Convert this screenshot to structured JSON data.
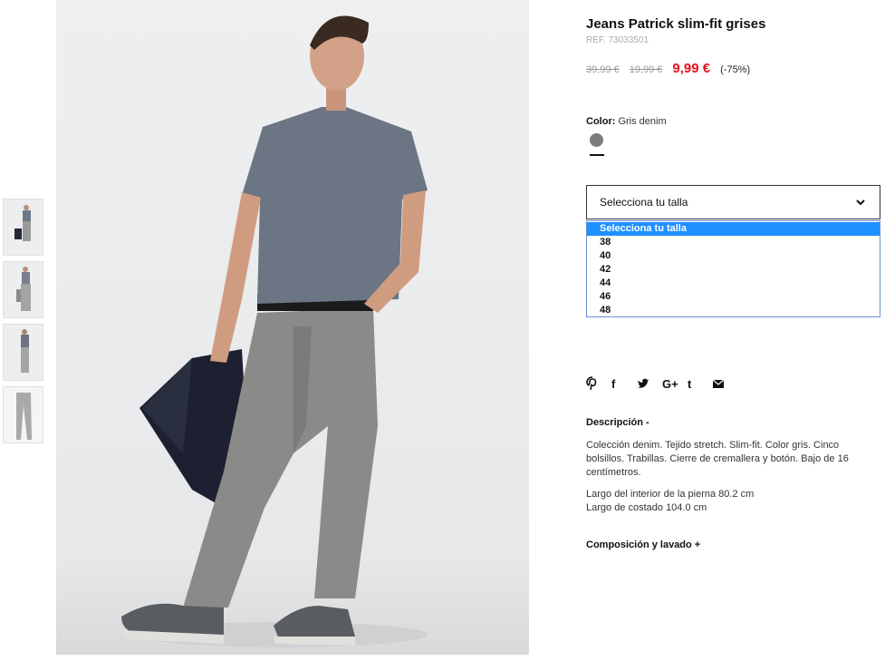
{
  "product": {
    "title": "Jeans Patrick slim-fit grises",
    "ref": "REF. 73033501",
    "price_original": "39,99 €",
    "price_previous": "19,99 €",
    "price_current": "9,99 €",
    "discount": "(-75%)"
  },
  "color": {
    "label": "Color:",
    "value": "Gris denim",
    "swatch_hex": "#7b7b7d"
  },
  "size": {
    "select_label": "Selecciona tu talla",
    "options": [
      "Selecciona tu talla",
      "38",
      "40",
      "42",
      "44",
      "46",
      "48"
    ],
    "selected_index": 0,
    "highlight_color": "#1e90ff"
  },
  "social": {
    "icons": [
      "pinterest-icon",
      "facebook-icon",
      "twitter-icon",
      "google-plus-icon",
      "tumblr-icon",
      "email-icon"
    ],
    "facebook_glyph": "f",
    "google_glyph": "G+",
    "tumblr_glyph": "t"
  },
  "description": {
    "heading": "Descripción -",
    "text": "Colección denim. Tejido stretch. Slim-fit. Color gris. Cinco bolsillos. Trabillas. Cierre de cremallera y botón. Bajo de 16 centímetros.",
    "inseam": "Largo del interior de la pierna 80.2 cm",
    "outseam": "Largo de costado 104.0 cm"
  },
  "composition": {
    "heading": "Composición y lavado +"
  },
  "colors": {
    "price_sale": "#e8101f",
    "text": "#111111",
    "muted": "#999999"
  }
}
